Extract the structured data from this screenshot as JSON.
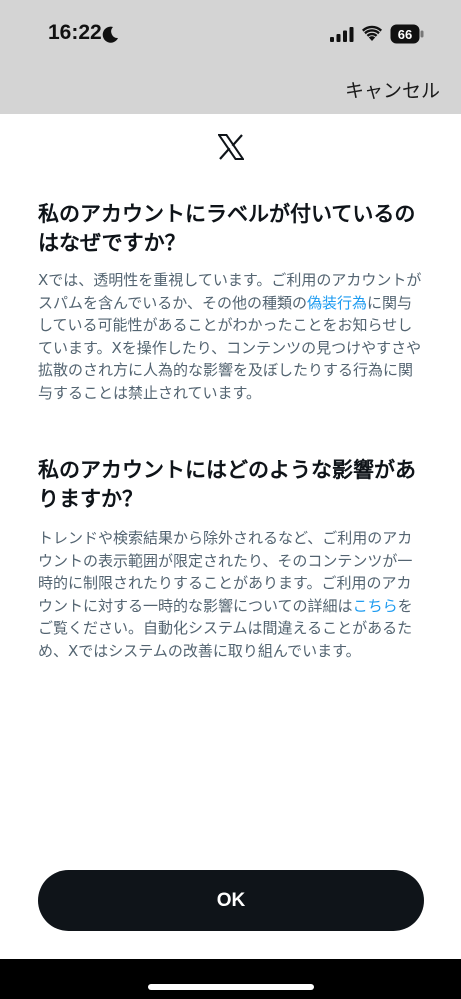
{
  "status_bar": {
    "time": "16:22",
    "battery_level": "66"
  },
  "header": {
    "cancel_label": "キャンセル"
  },
  "content": {
    "heading1": "私のアカウントにラベルが付いているのはなぜですか？",
    "para1": {
      "before": "Xでは、透明性を重視しています。ご利用のアカウントがスパムを含んでいるか、その他の種類の",
      "link": "偽装行為",
      "after": "に関与している可能性があることがわかったことをお知らせしています。Xを操作したり、コンテンツの見つけやすさや拡散のされ方に人為的な影響を及ぼしたりする行為に関与することは禁止されています。"
    },
    "heading2": "私のアカウントにはどのような影響がありますか？",
    "para2": {
      "before": "トレンドや検索結果から除外されるなど、ご利用のアカウントの表示範囲が限定されたり、そのコンテンツが一時的に制限されたりすることがあります。ご利用のアカウントに対する一時的な影響についての詳細は",
      "link": "こちら",
      "after": "をご覧ください。自動化システムは間違えることがあるため、Xではシステムの改善に取り組んでいます。"
    }
  },
  "footer": {
    "ok_label": "OK"
  },
  "colors": {
    "link": "#1d9bf0",
    "button_bg": "#0f1419",
    "top_bar_bg": "#d4d4d4"
  }
}
